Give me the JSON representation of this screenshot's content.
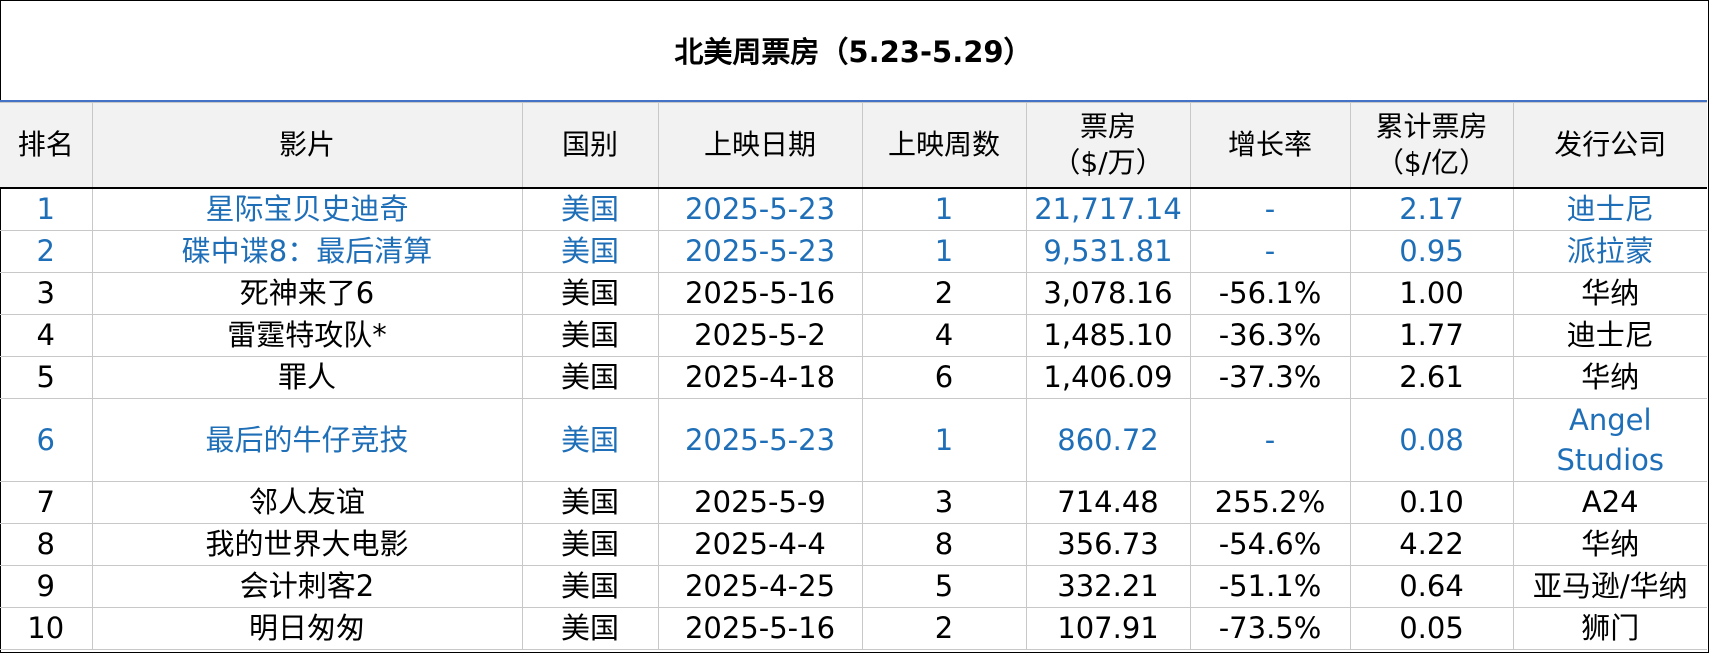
{
  "title": "北美周票房（5.23-5.29）",
  "chart_data": {
    "type": "table",
    "title": "北美周票房（5.23-5.29）",
    "columns": [
      "排名",
      "影片",
      "国别",
      "上映日期",
      "上映周数",
      "票房（$/万）",
      "增长率",
      "累计票房（$/亿）",
      "发行公司"
    ],
    "header": {
      "rank": "排名",
      "film": "影片",
      "country": "国别",
      "release_date": "上映日期",
      "weeks": "上映周数",
      "gross_line1": "票房",
      "gross_line2": "（$/万）",
      "growth": "增长率",
      "cumulative_line1": "累计票房",
      "cumulative_line2": "（$/亿）",
      "distributor": "发行公司"
    },
    "rows": [
      {
        "rank": "1",
        "film": "星际宝贝史迪奇",
        "country": "美国",
        "release_date": "2025-5-23",
        "weeks": "1",
        "gross": "21,717.14",
        "growth": "-",
        "cumulative": "2.17",
        "distributor": "迪士尼",
        "is_new": true
      },
      {
        "rank": "2",
        "film": "碟中谍8：最后清算",
        "country": "美国",
        "release_date": "2025-5-23",
        "weeks": "1",
        "gross": "9,531.81",
        "growth": "-",
        "cumulative": "0.95",
        "distributor": "派拉蒙",
        "is_new": true
      },
      {
        "rank": "3",
        "film": "死神来了6",
        "country": "美国",
        "release_date": "2025-5-16",
        "weeks": "2",
        "gross": "3,078.16",
        "growth": "-56.1%",
        "cumulative": "1.00",
        "distributor": "华纳",
        "is_new": false
      },
      {
        "rank": "4",
        "film": "雷霆特攻队*",
        "country": "美国",
        "release_date": "2025-5-2",
        "weeks": "4",
        "gross": "1,485.10",
        "growth": "-36.3%",
        "cumulative": "1.77",
        "distributor": "迪士尼",
        "is_new": false
      },
      {
        "rank": "5",
        "film": "罪人",
        "country": "美国",
        "release_date": "2025-4-18",
        "weeks": "6",
        "gross": "1,406.09",
        "growth": "-37.3%",
        "cumulative": "2.61",
        "distributor": "华纳",
        "is_new": false
      },
      {
        "rank": "6",
        "film": "最后的牛仔竞技",
        "country": "美国",
        "release_date": "2025-5-23",
        "weeks": "1",
        "gross": "860.72",
        "growth": "-",
        "cumulative": "0.08",
        "distributor": "Angel Studios",
        "is_new": true
      },
      {
        "rank": "7",
        "film": "邻人友谊",
        "country": "美国",
        "release_date": "2025-5-9",
        "weeks": "3",
        "gross": "714.48",
        "growth": "255.2%",
        "cumulative": "0.10",
        "distributor": "A24",
        "is_new": false
      },
      {
        "rank": "8",
        "film": "我的世界大电影",
        "country": "美国",
        "release_date": "2025-4-4",
        "weeks": "8",
        "gross": "356.73",
        "growth": "-54.6%",
        "cumulative": "4.22",
        "distributor": "华纳",
        "is_new": false
      },
      {
        "rank": "9",
        "film": "会计刺客2",
        "country": "美国",
        "release_date": "2025-4-25",
        "weeks": "5",
        "gross": "332.21",
        "growth": "-51.1%",
        "cumulative": "0.64",
        "distributor": "亚马逊/华纳",
        "is_new": false
      },
      {
        "rank": "10",
        "film": "明日匆匆",
        "country": "美国",
        "release_date": "2025-5-16",
        "weeks": "2",
        "gross": "107.91",
        "growth": "-73.5%",
        "cumulative": "0.05",
        "distributor": "狮门",
        "is_new": false
      }
    ]
  },
  "colors": {
    "new_release_text": "#1f6fb8",
    "header_bg": "#f2f2f2",
    "title_rule": "#4472c4",
    "grid": "#c8c8c8"
  }
}
